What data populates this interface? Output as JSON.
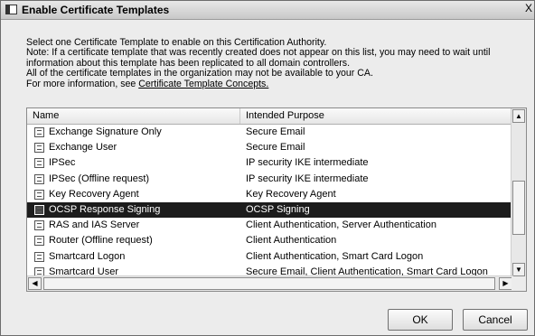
{
  "window": {
    "title": "Enable Certificate Templates",
    "close_glyph": "X"
  },
  "description": {
    "line1": "Select one Certificate Template to enable on this Certification Authority.",
    "line2": "Note: If a certificate template that was recently created does not appear on this list, you may need to wait until",
    "line3": "information about this template has been replicated to all domain controllers.",
    "line4": "All of the certificate templates in the organization may not be available to your CA.",
    "line5_prefix": "For more information, see ",
    "link": "Certificate Template Concepts."
  },
  "list": {
    "columns": {
      "name": "Name",
      "purpose": "Intended Purpose"
    },
    "rows": [
      {
        "name": "Exchange Signature Only",
        "purpose": "Secure Email",
        "icon": "certificate-template-icon"
      },
      {
        "name": "Exchange User",
        "purpose": "Secure Email",
        "icon": "certificate-template-icon"
      },
      {
        "name": "IPSec",
        "purpose": "IP security IKE intermediate",
        "icon": "certificate-template-icon"
      },
      {
        "name": "IPSec (Offline request)",
        "purpose": "IP security IKE intermediate",
        "icon": "certificate-template-icon"
      },
      {
        "name": "Key Recovery Agent",
        "purpose": "Key Recovery Agent",
        "icon": "certificate-template-icon"
      },
      {
        "name": "OCSP Response Signing",
        "purpose": "OCSP Signing",
        "icon": "certificate-template-icon",
        "selected": true
      },
      {
        "name": "RAS and IAS Server",
        "purpose": "Client Authentication, Server Authentication",
        "icon": "certificate-template-icon"
      },
      {
        "name": "Router (Offline request)",
        "purpose": "Client Authentication",
        "icon": "certificate-template-icon"
      },
      {
        "name": "Smartcard Logon",
        "purpose": "Client Authentication, Smart Card Logon",
        "icon": "certificate-template-icon"
      },
      {
        "name": "Smartcard User",
        "purpose": "Secure Email, Client Authentication, Smart Card Logon",
        "icon": "certificate-template-icon"
      }
    ],
    "selected_index": 5
  },
  "buttons": {
    "ok": "OK",
    "cancel": "Cancel"
  },
  "scroll_glyphs": {
    "up": "▲",
    "down": "▼",
    "left": "◀",
    "right": "▶"
  },
  "colors": {
    "selection_bg": "#1c1c1c",
    "selection_fg": "#ffffff",
    "dialog_bg": "#ececec"
  }
}
